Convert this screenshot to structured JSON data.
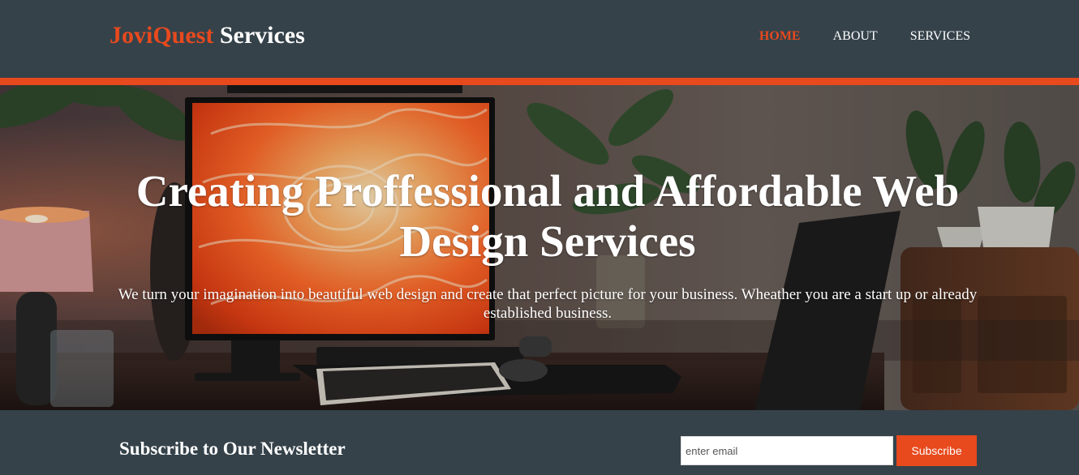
{
  "brand": {
    "accent": "JoviQuest",
    "rest": " Services"
  },
  "nav": {
    "items": [
      {
        "label": "Home",
        "active": true
      },
      {
        "label": "About",
        "active": false
      },
      {
        "label": "Services",
        "active": false
      }
    ]
  },
  "hero": {
    "title": "Creating Proffessional and Affordable Web Design Services",
    "subtitle": "We turn your imagination into beautiful web design and create that perfect picture for your business. Wheather you are a start up or already established business."
  },
  "newsletter": {
    "heading": "Subscribe to Our Newsletter",
    "email_placeholder": "enter email",
    "email_value": "",
    "button_label": "Subscribe"
  },
  "colors": {
    "accent": "#e8491d",
    "header_bg": "#35424a",
    "text_light": "#ffffff"
  },
  "icons": {
    "hero_photo": "desk-workspace-photo"
  }
}
